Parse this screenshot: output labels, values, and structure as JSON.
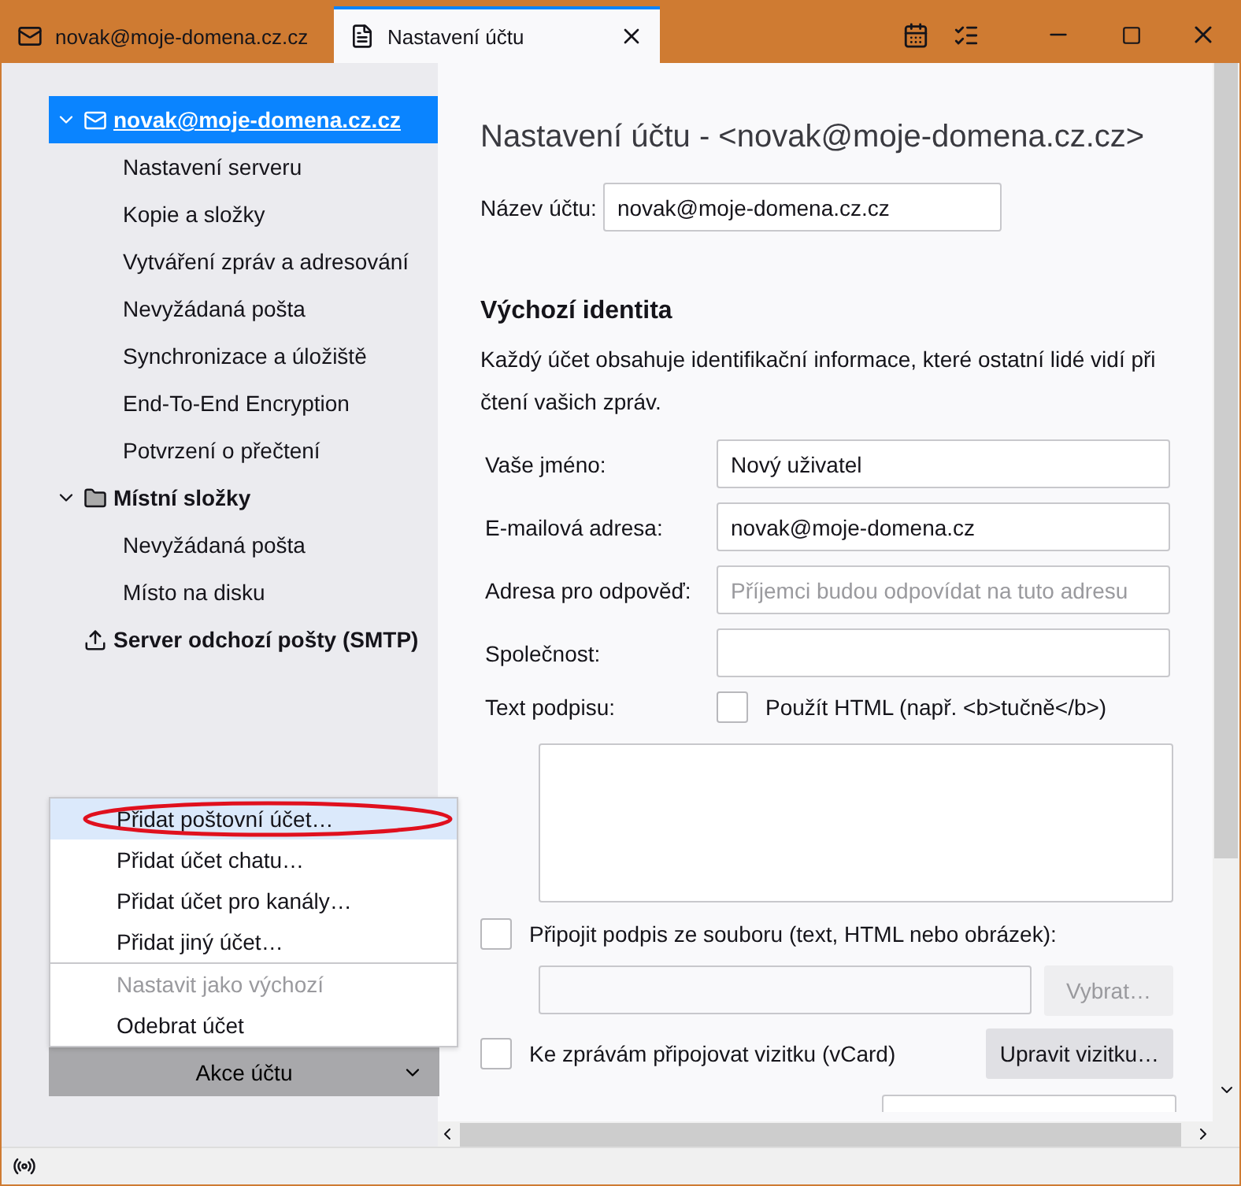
{
  "tabs": [
    {
      "label": "novak@moje-domena.cz.cz",
      "kind": "mail",
      "selected": false
    },
    {
      "label": "Nastavení účtu",
      "kind": "settings",
      "selected": true
    }
  ],
  "sidebar": {
    "accounts": [
      {
        "label": "novak@moje-domena.cz.cz",
        "kind": "mail",
        "expanded": true,
        "selected": true,
        "children": [
          {
            "label": "Nastavení serveru",
            "selected": false
          },
          {
            "label": "Kopie a složky",
            "selected": false
          },
          {
            "label": "Vytváření zpráv a adresování",
            "selected": false
          },
          {
            "label": "Nevyžádaná pošta",
            "selected": false
          },
          {
            "label": "Synchronizace a úložiště",
            "selected": false
          },
          {
            "label": "End-To-End Encryption",
            "selected": false
          },
          {
            "label": "Potvrzení o přečtení",
            "selected": false
          }
        ]
      },
      {
        "label": "Místní složky",
        "kind": "folder",
        "expanded": true,
        "selected": false,
        "children": [
          {
            "label": "Nevyžádaná pošta",
            "selected": false
          },
          {
            "label": "Místo na disku",
            "selected": false
          }
        ]
      },
      {
        "label": "Server odchozí pošty (SMTP)",
        "kind": "outbox",
        "selected": false
      }
    ]
  },
  "account_menu": {
    "sections": [
      {
        "items": [
          {
            "label": "Přidat poštovní účet…",
            "selected": true,
            "disabled": false,
            "circled": true
          },
          {
            "label": "Přidat účet chatu…",
            "selected": false,
            "disabled": false,
            "circled": false
          },
          {
            "label": "Přidat účet pro kanály…",
            "selected": false,
            "disabled": false,
            "circled": false
          },
          {
            "label": "Přidat jiný účet…",
            "selected": false,
            "disabled": false,
            "circled": false
          }
        ]
      },
      {
        "items": [
          {
            "label": "Nastavit jako výchozí",
            "selected": false,
            "disabled": true,
            "circled": false
          },
          {
            "label": "Odebrat účet",
            "selected": false,
            "disabled": false,
            "circled": false
          }
        ]
      }
    ]
  },
  "account_actions_button": {
    "label": "Akce účtu"
  },
  "content": {
    "title": "Nastavení účtu - <novak@moje-domena.cz.cz>",
    "account_name": {
      "label": "Název účtu:",
      "value": "novak@moje-domena.cz.cz"
    },
    "identity": {
      "heading": "Výchozí identita",
      "description": "Každý účet obsahuje identifikační informace, které ostatní lidé vidí při čtení vašich zpráv.",
      "fields": [
        {
          "label": "Vaše jméno:",
          "value": "Nový uživatel"
        },
        {
          "label": "E-mailová adresa:",
          "value": "novak@moje-domena.cz"
        },
        {
          "label": "Adresa pro odpověď:",
          "placeholder": "Příjemci budou odpovídat na tuto adresu"
        },
        {
          "label": "Společnost:"
        }
      ]
    },
    "signature": {
      "label": "Text podpisu:",
      "html_option": {
        "label": "Použít HTML (např. <b>tučně</b>)",
        "checked": false
      }
    },
    "attach_file": {
      "label": "Připojit podpis ze souboru (text, HTML nebo obrázek):",
      "checked": false,
      "button": {
        "label": "Vybrat…",
        "disabled": true
      }
    },
    "vcard": {
      "label": "Ke zprávám připojovat vizitku (vCard)",
      "checked": false,
      "button": {
        "label": "Upravit vizitku…",
        "disabled": false
      }
    }
  }
}
